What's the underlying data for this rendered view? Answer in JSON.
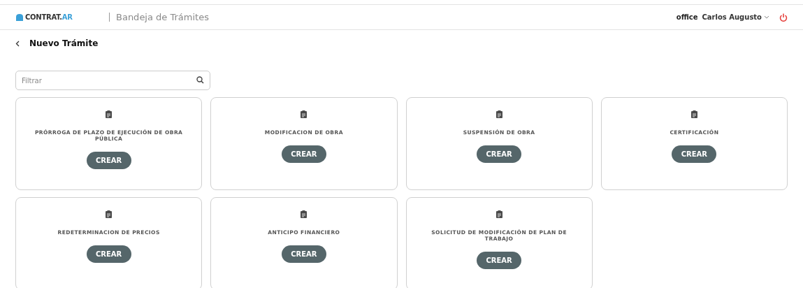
{
  "header": {
    "logo": {
      "text": "CONTRAT.",
      "suffix": "AR"
    },
    "title": "Bandeja de Trámites",
    "role": "office",
    "user": "Carlos Augusto"
  },
  "page_title": "Nuevo Trámite",
  "filter": {
    "placeholder": "Filtrar"
  },
  "cards": [
    {
      "title": "PRÓRROGA DE PLAZO DE EJECUCIÓN DE OBRA PÚBLICA",
      "button": "CREAR"
    },
    {
      "title": "MODIFICACION DE OBRA",
      "button": "CREAR"
    },
    {
      "title": "SUSPENSIÓN DE OBRA",
      "button": "CREAR"
    },
    {
      "title": "CERTIFICACIÓN",
      "button": "CREAR"
    },
    {
      "title": "REDETERMINACION DE PRECIOS",
      "button": "CREAR"
    },
    {
      "title": "ANTICIPO FINANCIERO",
      "button": "CREAR"
    },
    {
      "title": "SOLICITUD DE MODIFICACIÓN DE PLAN DE TRABAJO",
      "button": "CREAR"
    }
  ]
}
